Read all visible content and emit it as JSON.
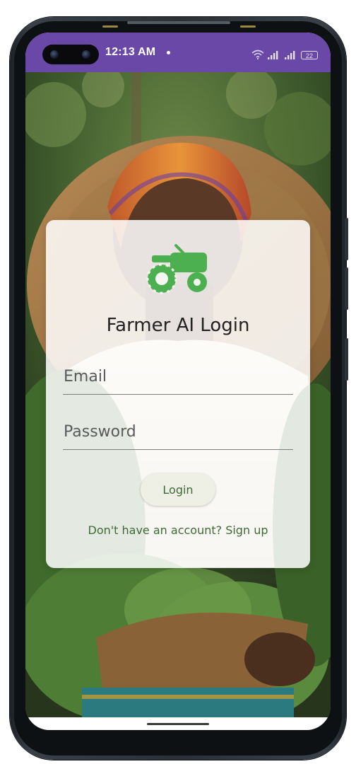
{
  "status_bar": {
    "time": "12:13 AM",
    "battery": "22",
    "background_color": "#6a48a8",
    "icons": [
      "wifi-icon",
      "signal-icon",
      "signal-icon",
      "battery-icon"
    ]
  },
  "background_photo": {
    "icon": "farmer-photo"
  },
  "login_card": {
    "logo_icon": "tractor-icon",
    "logo_color": "#4caf50",
    "title": "Farmer AI Login",
    "email_placeholder": "Email",
    "password_placeholder": "Password",
    "login_label": "Login",
    "signup_text": "Don't have an account? Sign up",
    "accent_color": "#3f6a36"
  }
}
